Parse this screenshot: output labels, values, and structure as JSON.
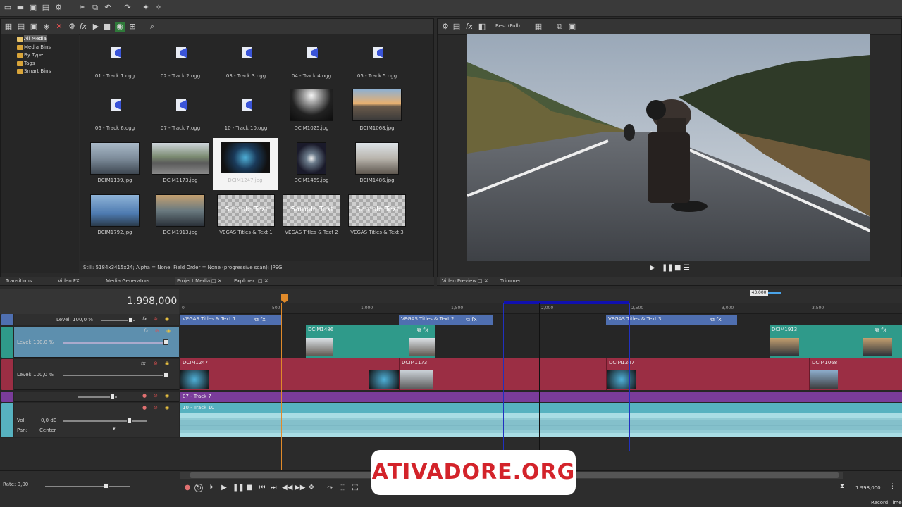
{
  "app": {
    "name": "VEGAS Pro"
  },
  "media_tree": {
    "items": [
      "All Media",
      "Media Bins",
      "By Type",
      "Tags",
      "Smart Bins"
    ]
  },
  "media_grid": {
    "items": [
      {
        "label": "01 - Track  1.ogg",
        "kind": "audio"
      },
      {
        "label": "02 - Track  2.ogg",
        "kind": "audio"
      },
      {
        "label": "03 - Track  3.ogg",
        "kind": "audio"
      },
      {
        "label": "04 - Track  4.ogg",
        "kind": "audio"
      },
      {
        "label": "05 - Track  5.ogg",
        "kind": "audio"
      },
      {
        "label": "06 - Track  6.ogg",
        "kind": "audio"
      },
      {
        "label": "07 - Track  7.ogg",
        "kind": "audio"
      },
      {
        "label": "10 - Track 10.ogg",
        "kind": "audio"
      },
      {
        "label": "DCIM1025.jpg",
        "kind": "image"
      },
      {
        "label": "DCIM1068.jpg",
        "kind": "image"
      },
      {
        "label": "DCIM1139.jpg",
        "kind": "image"
      },
      {
        "label": "DCIM1173.jpg",
        "kind": "image"
      },
      {
        "label": "DCIM1247.jpg",
        "kind": "image",
        "selected": true
      },
      {
        "label": "DCIM1469.jpg",
        "kind": "image"
      },
      {
        "label": "DCIM1486.jpg",
        "kind": "image"
      },
      {
        "label": "DCIM1792.jpg",
        "kind": "image"
      },
      {
        "label": "DCIM1913.jpg",
        "kind": "image"
      },
      {
        "label": "VEGAS Titles & Text 1",
        "kind": "text",
        "thumb_text": "Sample Text"
      },
      {
        "label": "VEGAS Titles & Text 2",
        "kind": "text",
        "thumb_text": "Sample Text"
      },
      {
        "label": "VEGAS Titles & Text 3",
        "kind": "text",
        "thumb_text": "Sample Text"
      }
    ],
    "status": "Still: 5184x3415x24; Alpha = None; Field Order = None (progressive scan); JPEG"
  },
  "left_tabs": [
    "Transitions",
    "Video FX",
    "Media Generators",
    "Project Media",
    "Explorer"
  ],
  "preview": {
    "quality": "Best (Full)",
    "tabs": [
      "Video Preview",
      "Trimmer"
    ]
  },
  "timeline": {
    "timecode": "1.998,000",
    "marker": "43,000",
    "ruler_labels": [
      "0",
      "500",
      "1,000",
      "1,500",
      "2,000",
      "2,500",
      "3,000",
      "3,500"
    ],
    "tracks": [
      {
        "type": "title",
        "level": "Level: 100,0 %",
        "clips": [
          "VEGAS Titles & Text 1",
          "VEGAS Titles & Text 2",
          "VEGAS Titles & Text 3"
        ]
      },
      {
        "type": "video",
        "level": "Level: 100,0 %",
        "clips": [
          "DCIM1486",
          "DCIM1913"
        ]
      },
      {
        "type": "video",
        "level": "Level: 100,0 %",
        "clips": [
          "DCIM1247",
          "DCIM1173",
          "DCIM1247",
          "DCIM1068"
        ]
      },
      {
        "type": "audio",
        "clips": [
          "07 - Track  7"
        ]
      },
      {
        "type": "audio",
        "vol_label": "Vol:",
        "vol_value": "0,0 dB",
        "pan_label": "Pan:",
        "pan_value": "Center",
        "clips": [
          "10 - Track 10"
        ]
      }
    ]
  },
  "bottom": {
    "rate": "Rate: 0,00",
    "end_time": "1.998,000",
    "record_label": "Record Time"
  },
  "watermark": "ATIVADORE.ORG",
  "colors": {
    "title_track": "#4f6fb0",
    "video_track_a": "#2f9a8a",
    "video_track_b": "#9b2e44",
    "audio_track_a": "#7a3c9a",
    "audio_track_b": "#57b2c0",
    "watermark_text": "#d3232a"
  }
}
